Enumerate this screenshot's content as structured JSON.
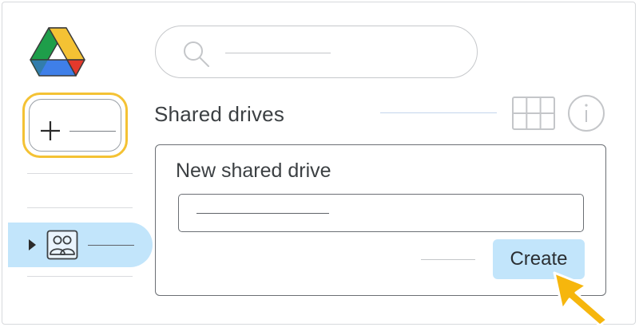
{
  "app": {
    "logo_icon": "google-drive-logo",
    "colors": {
      "highlight_yellow": "#f4c234",
      "selected_blue": "#c2e5fb",
      "text_dark": "#3c4043"
    }
  },
  "sidebar": {
    "new_button": {
      "icon": "plus-icon"
    },
    "items": [
      {
        "icon": "shared-drives-icon",
        "expander": "caret-right-icon",
        "selected": true
      }
    ]
  },
  "search": {
    "icon": "search-icon"
  },
  "header": {
    "title": "Shared drives",
    "actions": [
      {
        "icon": "grid-view-icon"
      },
      {
        "icon": "info-icon"
      }
    ]
  },
  "dialog": {
    "title": "New shared drive",
    "create_label": "Create"
  },
  "pointer": {
    "icon": "cursor-arrow-icon"
  }
}
